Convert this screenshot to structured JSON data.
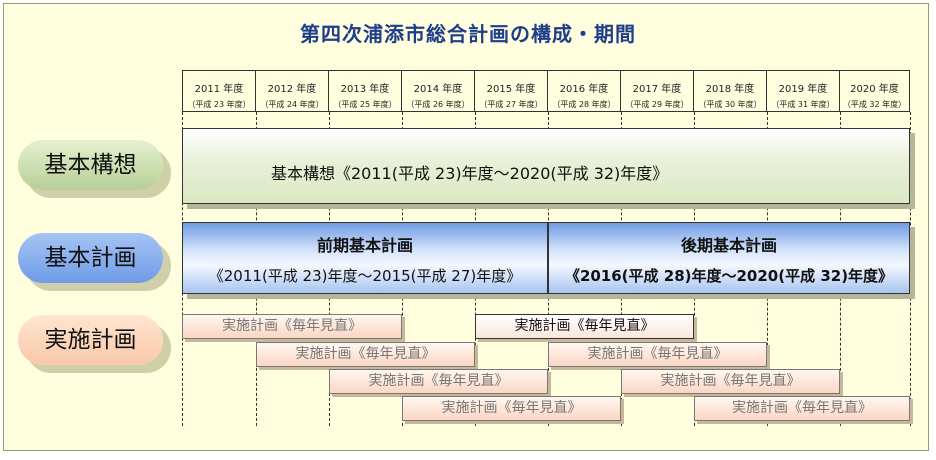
{
  "title": "第四次浦添市総合計画の構成・期間",
  "years": [
    {
      "year": "2011 年度",
      "heisei": "（平成 23 年度）"
    },
    {
      "year": "2012 年度",
      "heisei": "（平成 24 年度）"
    },
    {
      "year": "2013 年度",
      "heisei": "（平成 25 年度）"
    },
    {
      "year": "2014 年度",
      "heisei": "（平成 26 年度）"
    },
    {
      "year": "2015 年度",
      "heisei": "（平成 27 年度）"
    },
    {
      "year": "2016 年度",
      "heisei": "（平成 28 年度）"
    },
    {
      "year": "2017 年度",
      "heisei": "（平成 29 年度）"
    },
    {
      "year": "2018 年度",
      "heisei": "（平成 30 年度）"
    },
    {
      "year": "2019 年度",
      "heisei": "（平成 31 年度）"
    },
    {
      "year": "2020 年度",
      "heisei": "（平成 32 年度）"
    }
  ],
  "labels": {
    "kihonkoso": "基本構想",
    "kihonkeikaku": "基本計画",
    "jisshi": "実施計画"
  },
  "kihonkoso_bar": "基本構想《2011(平成 23)年度～2020(平成 32)年度》",
  "zenki": {
    "title": "前期基本計画",
    "period": "《2011(平成 23)年度～2015(平成 27)年度》"
  },
  "koki": {
    "title": "後期基本計画",
    "period": "《2016(平成 28)年度～2020(平成 32)年度》"
  },
  "jisshi_item": "実施計画《毎年見直》"
}
